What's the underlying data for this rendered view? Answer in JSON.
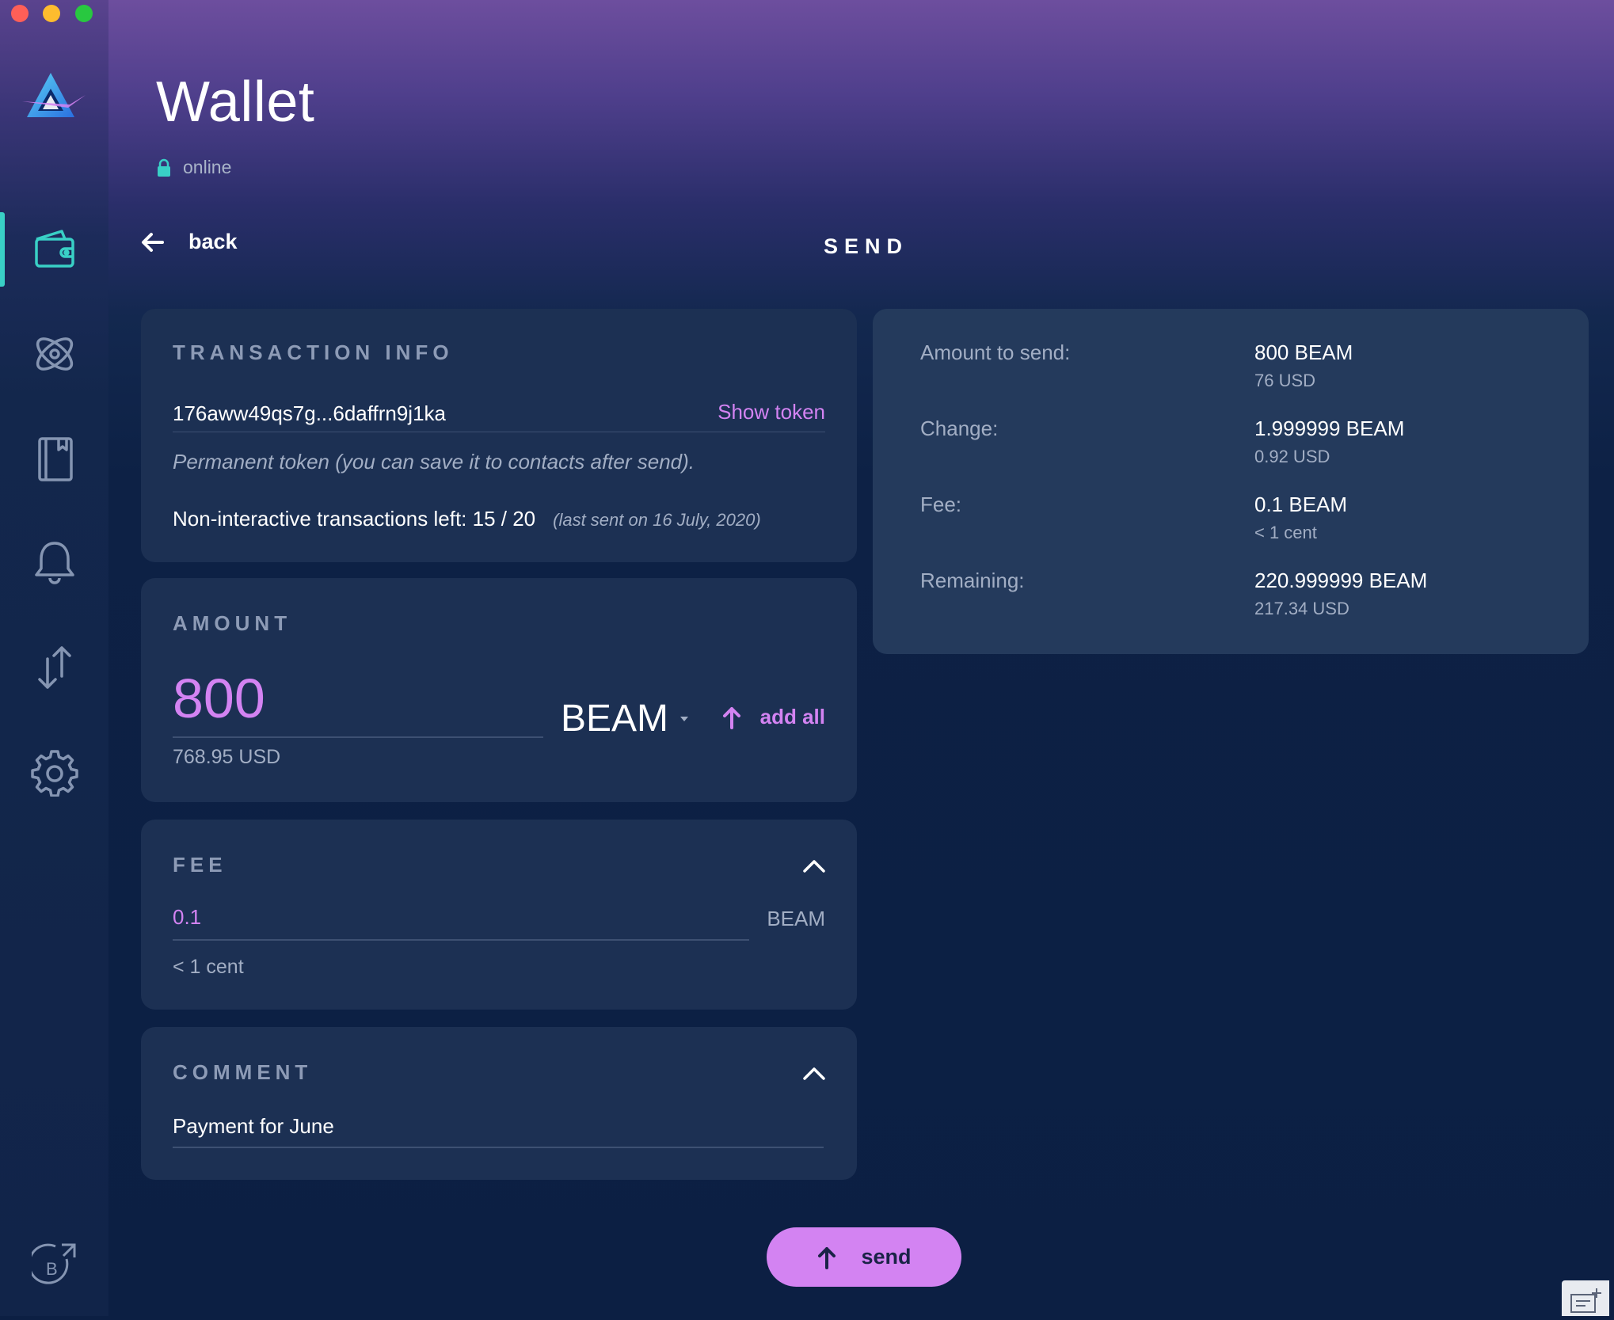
{
  "window": {
    "title": "Wallet",
    "status": "online"
  },
  "colors": {
    "accent": "#d383f2",
    "teal": "#39d0c6",
    "panel": "#1c3053",
    "panel_alt": "#243a5c",
    "muted": "#a2aec4"
  },
  "sidebar": {
    "items": [
      {
        "name": "wallet",
        "icon": "wallet-icon",
        "active": true
      },
      {
        "name": "atomic-swap",
        "icon": "atom-icon",
        "active": false
      },
      {
        "name": "address-book",
        "icon": "book-icon",
        "active": false
      },
      {
        "name": "notifications",
        "icon": "bell-icon",
        "active": false
      },
      {
        "name": "transactions",
        "icon": "arrows-updown-icon",
        "active": false
      },
      {
        "name": "settings",
        "icon": "gear-icon",
        "active": false
      }
    ],
    "footer_icon": "beam-external-link-icon"
  },
  "nav": {
    "back_label": "back",
    "page_heading": "SEND"
  },
  "transaction_info": {
    "title": "TRANSACTION INFO",
    "token": "176aww49qs7g...6daffrn9j1ka",
    "show_token_label": "Show token",
    "token_note": "Permanent token (you can save it to contacts after send).",
    "non_interactive_label": "Non-interactive transactions left: 15 / 20",
    "last_sent": "(last sent on 16 July, 2020)"
  },
  "amount": {
    "title": "AMOUNT",
    "value": "800",
    "usd": "768.95 USD",
    "currency": "BEAM",
    "add_all_label": "add all"
  },
  "fee": {
    "title": "FEE",
    "value": "0.1",
    "unit": "BEAM",
    "usd": "< 1 cent"
  },
  "comment": {
    "title": "COMMENT",
    "value": "Payment for June"
  },
  "summary": {
    "rows": [
      {
        "label": "Amount to send:",
        "value": "800 BEAM",
        "sub": "76 USD"
      },
      {
        "label": "Change:",
        "value": "1.999999 BEAM",
        "sub": "0.92 USD"
      },
      {
        "label": "Fee:",
        "value": "0.1 BEAM",
        "sub": "< 1 cent"
      },
      {
        "label": "Remaining:",
        "value": "220.999999 BEAM",
        "sub": "217.34 USD"
      }
    ]
  },
  "send_button": {
    "label": "send"
  }
}
